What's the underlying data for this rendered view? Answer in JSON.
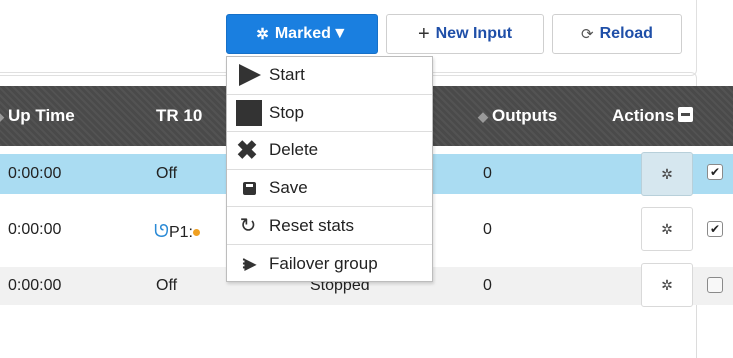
{
  "toolbar": {
    "marked_label": "Marked",
    "marked_caret": "▼",
    "new_input_label": "New Input",
    "reload_label": "Reload"
  },
  "table": {
    "headers": {
      "up_time": "Up Time",
      "tr_partial": "TR 10",
      "outputs": "Outputs",
      "actions": "Actions"
    },
    "rows": [
      {
        "up_time": "0:00:00",
        "tr": "Off",
        "status": "",
        "outputs": "0",
        "checked": true
      },
      {
        "up_time": "0:00:00",
        "tr": "P1:",
        "status": "",
        "outputs": "0",
        "checked": true
      },
      {
        "up_time": "0:00:00",
        "tr": "Off",
        "status": "Stopped",
        "outputs": "0",
        "checked": false
      }
    ]
  },
  "menu": {
    "items": [
      {
        "label": "Start",
        "icon": "play-icon"
      },
      {
        "label": "Stop",
        "icon": "stop-icon"
      },
      {
        "label": "Delete",
        "icon": "delete-icon"
      },
      {
        "label": "Save",
        "icon": "save-icon"
      },
      {
        "label": "Reset stats",
        "icon": "reset-icon"
      },
      {
        "label": "Failover group",
        "icon": "failover-icon"
      }
    ]
  },
  "colors": {
    "accent": "#1a7fe0",
    "header_bg": "#4a4a4a",
    "selected_row": "#aadcf2",
    "link_text": "#1f4fa8"
  }
}
